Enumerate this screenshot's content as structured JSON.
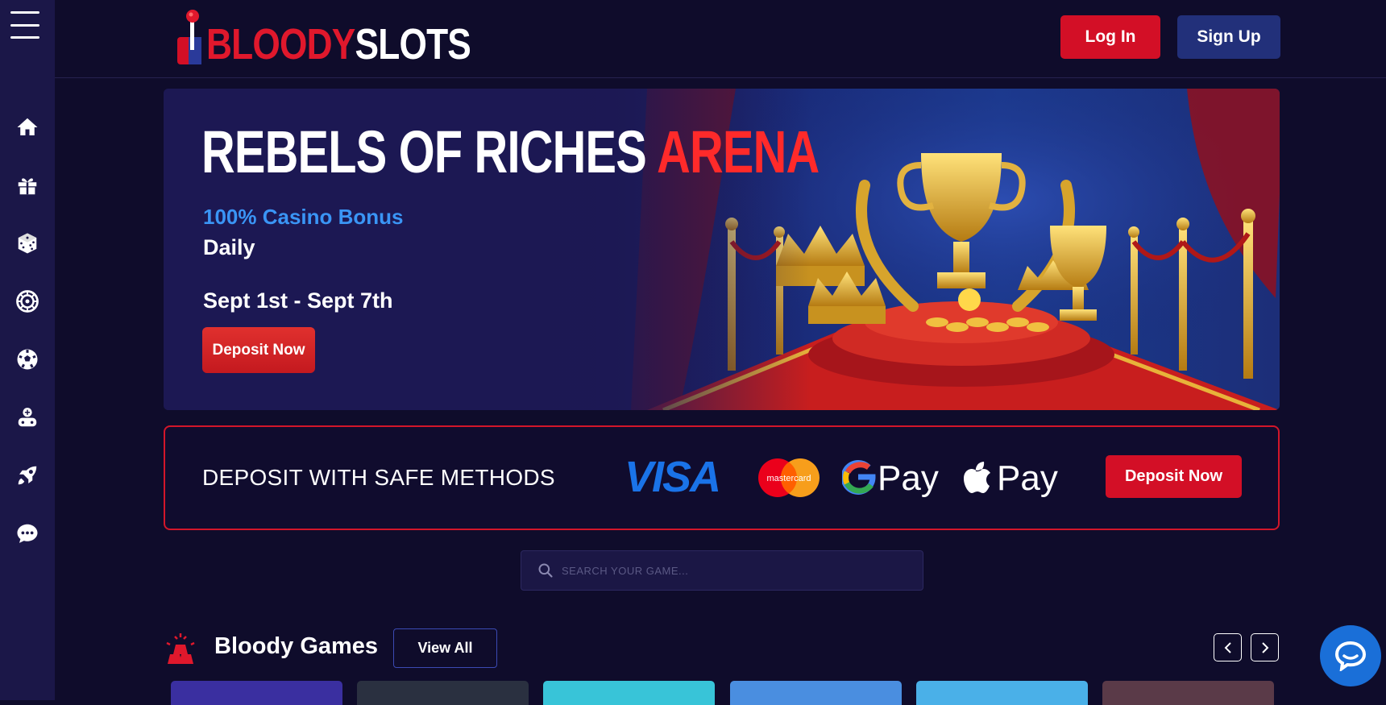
{
  "brand": {
    "logo_part_red": "BLOODY",
    "logo_part_white": "SLOTS",
    "accent_red": "#d30f26",
    "accent_blue": "#22307a"
  },
  "header": {
    "login_label": "Log In",
    "signup_label": "Sign Up"
  },
  "sidebar": {
    "items": [
      {
        "icon": "home-icon"
      },
      {
        "icon": "gift-icon"
      },
      {
        "icon": "dice-icon"
      },
      {
        "icon": "roulette-icon"
      },
      {
        "icon": "soccer-ball-icon"
      },
      {
        "icon": "gamer-icon"
      },
      {
        "icon": "rocket-icon"
      },
      {
        "icon": "chat-bubble-icon"
      }
    ]
  },
  "banner": {
    "title_main": "REBELS OF RICHES ",
    "title_highlight": "ARENA",
    "bonus": "100% Casino Bonus",
    "frequency": "Daily",
    "dates": "Sept 1st - Sept 7th",
    "cta": "Deposit Now"
  },
  "deposit": {
    "title": "DEPOSIT WITH SAFE METHODS",
    "methods": [
      "VISA",
      "mastercard",
      "Pay",
      "Pay"
    ],
    "cta": "Deposit Now"
  },
  "search": {
    "placeholder": "SEARCH YOUR GAME..."
  },
  "games": {
    "title": "Bloody Games",
    "view_all": "View All",
    "thumb_colors": [
      "#3a2fa0",
      "#2a3040",
      "#38c4d8",
      "#4a8ee0",
      "#4ab0e8",
      "#5a3a48"
    ]
  }
}
